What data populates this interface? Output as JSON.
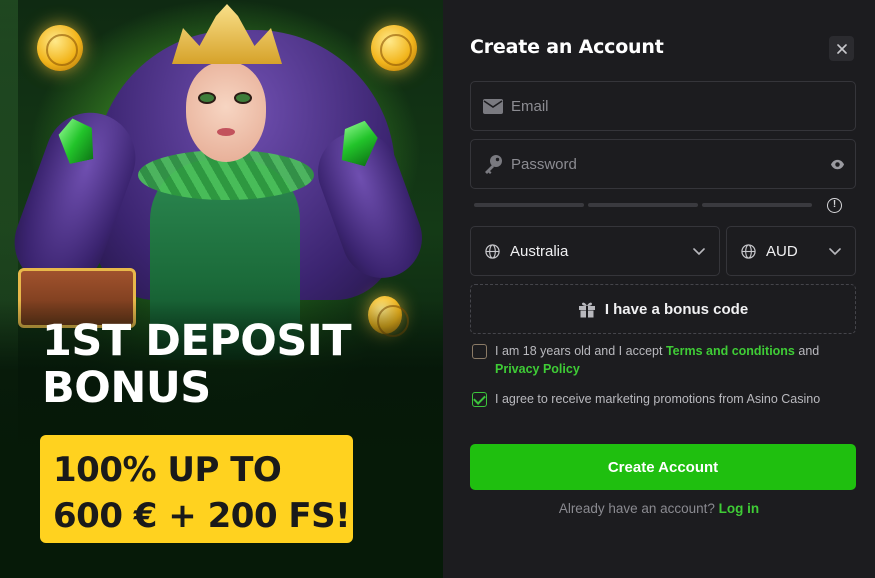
{
  "promo": {
    "title_line1": "1ST DEPOSIT",
    "title_line2": "BONUS",
    "offer_line1": "100% UP TO",
    "offer_line2": "600 € + 200 FS!",
    "badge_color": "#ffd21f"
  },
  "form": {
    "title": "Create an Account",
    "close_icon": "close-icon",
    "email": {
      "placeholder": "Email",
      "value": "",
      "icon": "envelope-icon"
    },
    "password": {
      "placeholder": "Password",
      "value": "",
      "icon": "key-icon",
      "toggle_icon": "eye-icon"
    },
    "password_strength_segments": 3,
    "country": {
      "value": "Australia",
      "icon": "globe-icon"
    },
    "currency": {
      "value": "AUD",
      "icon": "globe-icon"
    },
    "bonus_code": {
      "label": "I have a bonus code",
      "icon": "gift-icon"
    },
    "terms": {
      "checked": false,
      "prefix": "I am 18 years old and I accept ",
      "terms_link": "Terms and conditions",
      "middle": " and ",
      "privacy_link": "Privacy Policy"
    },
    "marketing": {
      "checked": true,
      "text": "I agree to receive marketing promotions from Asino Casino"
    },
    "submit_label": "Create Account",
    "login_prompt": "Already have an account? ",
    "login_link": "Log in",
    "accent_color": "#1fbf0f"
  }
}
